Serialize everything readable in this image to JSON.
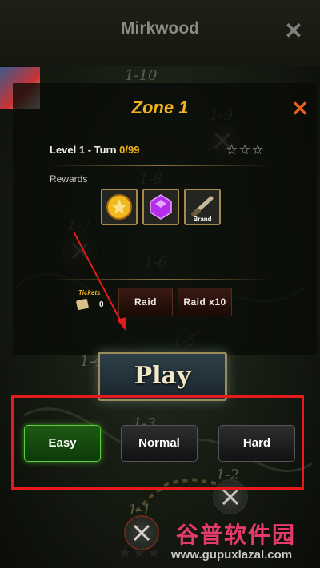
{
  "header": {
    "title": "Mirkwood",
    "close_glyph": "✕"
  },
  "map": {
    "stage_labels": [
      "1-10",
      "1-9",
      "1-8",
      "1-7",
      "1-6",
      "1-5",
      "1-4",
      "1-3",
      "1-2",
      "1-1"
    ]
  },
  "zone_popup": {
    "title": "Zone 1",
    "close_glyph": "✕",
    "level_text": "Level 1 - Turn ",
    "turn_value": "0/99",
    "stars": "☆☆☆",
    "rewards_label": "Rewards",
    "rewards": [
      {
        "icon": "gold-coin-icon",
        "label": ""
      },
      {
        "icon": "purple-gem-icon",
        "label": ""
      },
      {
        "icon": "brand-item-icon",
        "label": "Brand"
      }
    ],
    "tickets_label": "Tickets",
    "tickets_count": "0",
    "raid_button": "Raid",
    "raid_x10_button": "Raid x10",
    "play_button": "Play"
  },
  "difficulty": {
    "options": [
      "Easy",
      "Normal",
      "Hard"
    ],
    "selected": "Easy"
  },
  "watermark": {
    "brand": "谷普软件园",
    "url": "www.gupuxlazal.com"
  },
  "colors": {
    "accent": "#f2b21c",
    "highlight_red": "#e51b1b",
    "selected_green": "#57d13a",
    "close_orange": "#e65f1a"
  }
}
